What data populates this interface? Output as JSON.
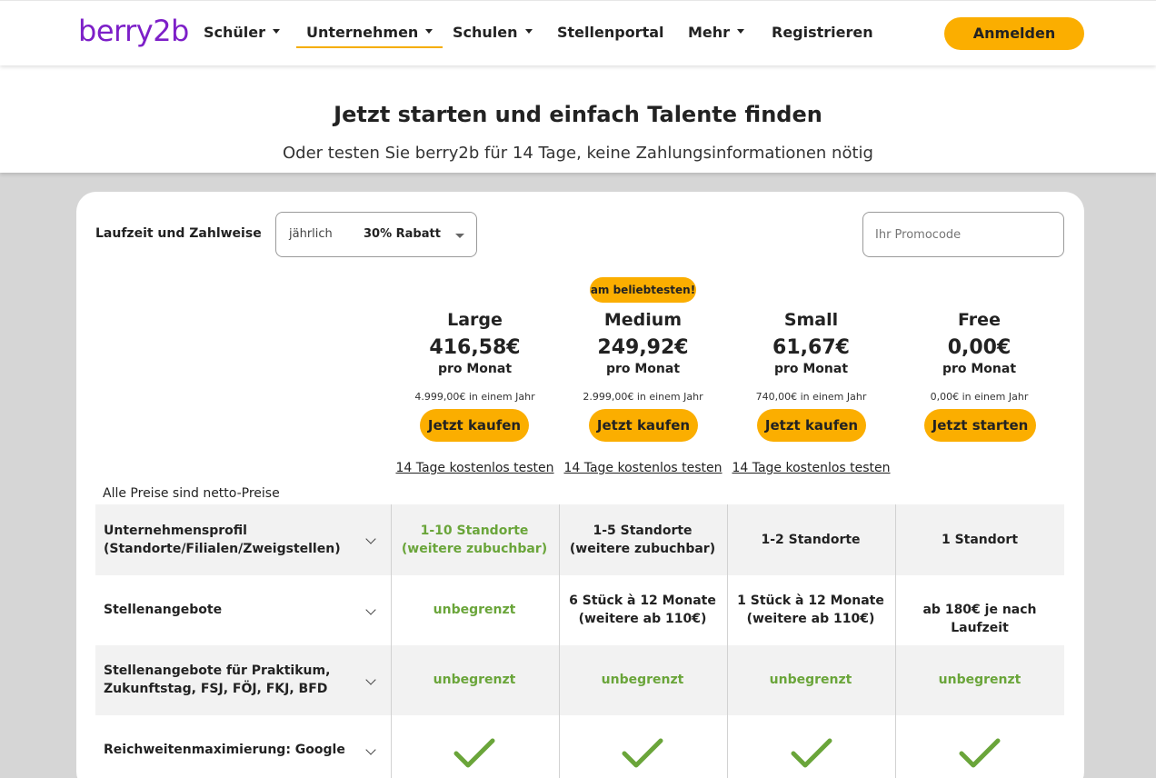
{
  "nav": {
    "logo": "berry2b",
    "items": [
      {
        "label": "Schüler",
        "has_caret": true
      },
      {
        "label": "Unternehmen",
        "has_caret": true,
        "active": true
      },
      {
        "label": "Schulen",
        "has_caret": true
      },
      {
        "label": "Stellenportal",
        "has_caret": false
      },
      {
        "label": "Mehr",
        "has_caret": true
      },
      {
        "label": "Registrieren",
        "has_caret": false
      }
    ],
    "login_label": "Anmelden"
  },
  "hero": {
    "title": "Jetzt starten und einfach Talente finden",
    "subtitle": "Oder testen Sie berry2b für 14 Tage, keine Zahlungsinformationen nötig"
  },
  "controls": {
    "term_label": "Laufzeit und Zahlweise",
    "term_value": "jährlich",
    "term_discount": "30% Rabatt",
    "promo_placeholder": "Ihr Promocode"
  },
  "badge": "am beliebtesten!",
  "plans": [
    {
      "name": "Large",
      "price": "416,58€",
      "per": "pro Monat",
      "yearly": "4.999,00€ in einem Jahr",
      "button": "Jetzt kaufen",
      "trial": "14 Tage kostenlos testen"
    },
    {
      "name": "Medium",
      "price": "249,92€",
      "per": "pro Monat",
      "yearly": "2.999,00€ in einem Jahr",
      "button": "Jetzt kaufen",
      "trial": "14 Tage kostenlos testen"
    },
    {
      "name": "Small",
      "price": "61,67€",
      "per": "pro Monat",
      "yearly": "740,00€ in einem Jahr",
      "button": "Jetzt kaufen",
      "trial": "14 Tage kostenlos testen"
    },
    {
      "name": "Free",
      "price": "0,00€",
      "per": "pro Monat",
      "yearly": "0,00€ in einem Jahr",
      "button": "Jetzt starten",
      "trial": ""
    }
  ],
  "netto_note": "Alle Preise sind netto-Preise",
  "features": [
    {
      "label_lines": [
        "Unternehmensprofil",
        "(Standorte/Filialen/Zweigstellen)"
      ],
      "cells": [
        {
          "lines": [
            "1-10 Standorte",
            "(weitere zubuchbar)"
          ],
          "green": true
        },
        {
          "lines": [
            "1-5 Standorte",
            "(weitere zubuchbar)"
          ],
          "green": false
        },
        {
          "lines": [
            "1-2 Standorte"
          ],
          "green": false
        },
        {
          "lines": [
            "1 Standort"
          ],
          "green": false
        }
      ]
    },
    {
      "label_lines": [
        "Stellenangebote"
      ],
      "cells": [
        {
          "lines": [
            "unbegrenzt"
          ],
          "green": true
        },
        {
          "lines": [
            "6 Stück à 12 Monate",
            "(weitere ab 110€)"
          ],
          "green": false
        },
        {
          "lines": [
            "1 Stück à 12 Monate",
            "(weitere ab 110€)"
          ],
          "green": false
        },
        {
          "lines": [
            "ab 180€ je nach Laufzeit"
          ],
          "green": false
        }
      ]
    },
    {
      "label_lines": [
        "Stellenangebote für Praktikum,",
        "Zukunftstag, FSJ, FÖJ, FKJ, BFD"
      ],
      "cells": [
        {
          "lines": [
            "unbegrenzt"
          ],
          "green": true
        },
        {
          "lines": [
            "unbegrenzt"
          ],
          "green": true
        },
        {
          "lines": [
            "unbegrenzt"
          ],
          "green": true
        },
        {
          "lines": [
            "unbegrenzt"
          ],
          "green": true
        }
      ]
    },
    {
      "label_lines": [
        "Reichweitenmaximierung: Google"
      ],
      "cells": [
        {
          "check": true
        },
        {
          "check": true
        },
        {
          "check": true
        },
        {
          "check": true
        }
      ]
    }
  ],
  "colors": {
    "brand_purple": "#7d1fc8",
    "accent_yellow": "#fbae00",
    "green": "#6aa53a"
  }
}
